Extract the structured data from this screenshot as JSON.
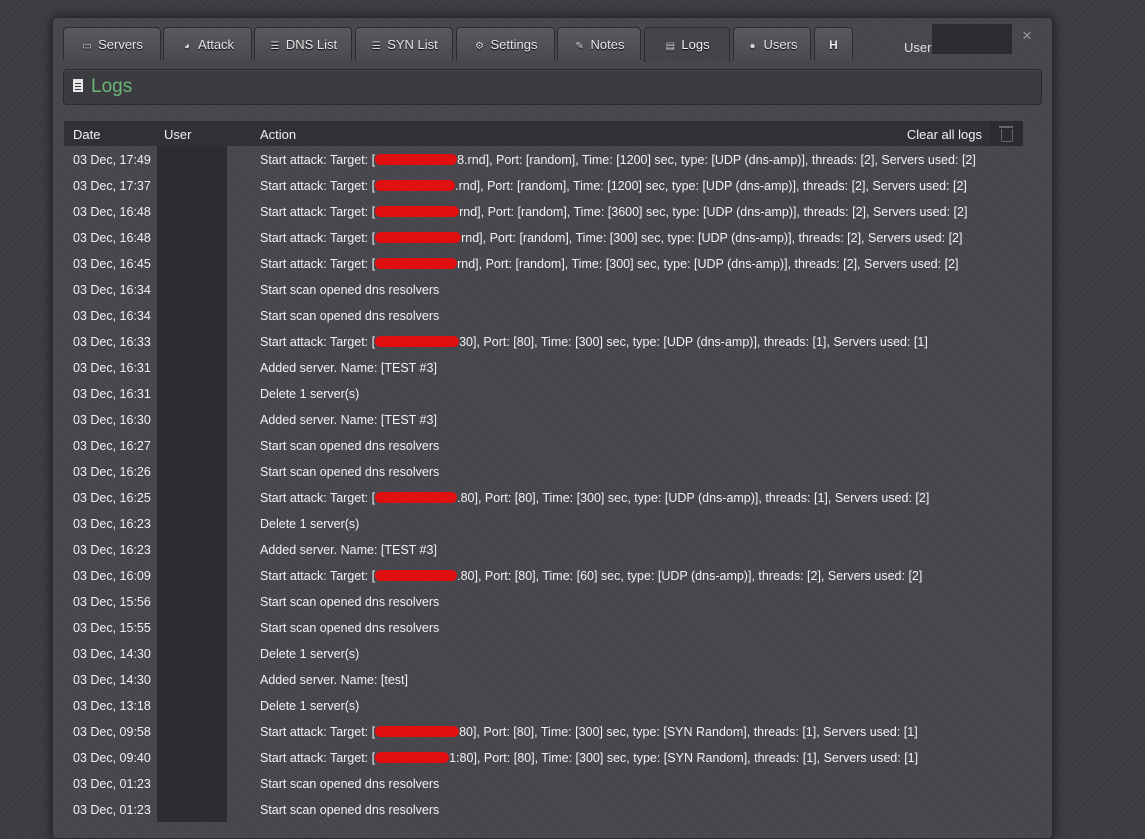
{
  "tabs": [
    {
      "label": "Servers",
      "icon": "server-icon"
    },
    {
      "label": "Attack",
      "icon": "dashboard-icon"
    },
    {
      "label": "DNS List",
      "icon": "list-icon"
    },
    {
      "label": "SYN List",
      "icon": "list-icon"
    },
    {
      "label": "Settings",
      "icon": "cogs-icon"
    },
    {
      "label": "Notes",
      "icon": "edit-icon"
    },
    {
      "label": "Logs",
      "icon": "document-icon",
      "active": true
    },
    {
      "label": "Users",
      "icon": "user-icon"
    },
    {
      "label": "H"
    }
  ],
  "header": {
    "user_label": "User",
    "close_symbol": "×"
  },
  "page": {
    "title": "Logs",
    "title_color": "#6ab778"
  },
  "table": {
    "columns": {
      "date": "Date",
      "user": "User",
      "action": "Action"
    },
    "clear_label": "Clear all logs",
    "redaction_color": "#e01010",
    "rows": [
      {
        "date": "03 Dec, 17:49",
        "pre": "Start attack: Target: [",
        "post": "8.rnd], Port: [random], Time: [1200] sec, type: [UDP (dns-amp)], threads: [2], Servers used: [2]"
      },
      {
        "date": "03 Dec, 17:37",
        "pre": "Start attack: Target: [",
        "post": ".rnd], Port: [random], Time: [1200] sec, type: [UDP (dns-amp)], threads: [2], Servers used: [2]"
      },
      {
        "date": "03 Dec, 16:48",
        "pre": "Start attack: Target: [",
        "post": "rnd], Port: [random], Time: [3600] sec, type: [UDP (dns-amp)], threads: [2], Servers used: [2]"
      },
      {
        "date": "03 Dec, 16:48",
        "pre": "Start attack: Target: [",
        "post": "rnd], Port: [random], Time: [300] sec, type: [UDP (dns-amp)], threads: [2], Servers used: [2]"
      },
      {
        "date": "03 Dec, 16:45",
        "pre": "Start attack: Target: [",
        "post": "rnd], Port: [random], Time: [300] sec, type: [UDP (dns-amp)], threads: [2], Servers used: [2]"
      },
      {
        "date": "03 Dec, 16:34",
        "pre": "Start scan opened dns resolvers"
      },
      {
        "date": "03 Dec, 16:34",
        "pre": "Start scan opened dns resolvers"
      },
      {
        "date": "03 Dec, 16:33",
        "pre": "Start attack: Target: [",
        "post": "30], Port: [80], Time: [300] sec, type: [UDP (dns-amp)], threads: [1], Servers used: [1]"
      },
      {
        "date": "03 Dec, 16:31",
        "pre": "Added server. Name: [TEST #3]"
      },
      {
        "date": "03 Dec, 16:31",
        "pre": "Delete 1 server(s)"
      },
      {
        "date": "03 Dec, 16:30",
        "pre": "Added server. Name: [TEST #3]"
      },
      {
        "date": "03 Dec, 16:27",
        "pre": "Start scan opened dns resolvers"
      },
      {
        "date": "03 Dec, 16:26",
        "pre": "Start scan opened dns resolvers"
      },
      {
        "date": "03 Dec, 16:25",
        "pre": "Start attack: Target: [",
        "post": ".80], Port: [80], Time: [300] sec, type: [UDP (dns-amp)], threads: [1], Servers used: [2]"
      },
      {
        "date": "03 Dec, 16:23",
        "pre": "Delete 1 server(s)"
      },
      {
        "date": "03 Dec, 16:23",
        "pre": "Added server. Name: [TEST #3]"
      },
      {
        "date": "03 Dec, 16:09",
        "pre": "Start attack: Target: [",
        "post": ".80], Port: [80], Time: [60] sec, type: [UDP (dns-amp)], threads: [2], Servers used: [2]"
      },
      {
        "date": "03 Dec, 15:56",
        "pre": "Start scan opened dns resolvers"
      },
      {
        "date": "03 Dec, 15:55",
        "pre": "Start scan opened dns resolvers"
      },
      {
        "date": "03 Dec, 14:30",
        "pre": "Delete 1 server(s)"
      },
      {
        "date": "03 Dec, 14:30",
        "pre": "Added server. Name: [test]"
      },
      {
        "date": "03 Dec, 13:18",
        "pre": "Delete 1 server(s)"
      },
      {
        "date": "03 Dec, 09:58",
        "pre": "Start attack: Target: [",
        "post": "80], Port: [80], Time: [300] sec, type: [SYN Random], threads: [1], Servers used: [1]"
      },
      {
        "date": "03 Dec, 09:40",
        "pre": "Start attack: Target: [",
        "post": "1:80], Port: [80], Time: [300] sec, type: [SYN Random], threads: [1], Servers used: [1]"
      },
      {
        "date": "03 Dec, 01:23",
        "pre": "Start scan opened dns resolvers"
      },
      {
        "date": "03 Dec, 01:23",
        "pre": "Start scan opened dns resolvers"
      }
    ]
  }
}
